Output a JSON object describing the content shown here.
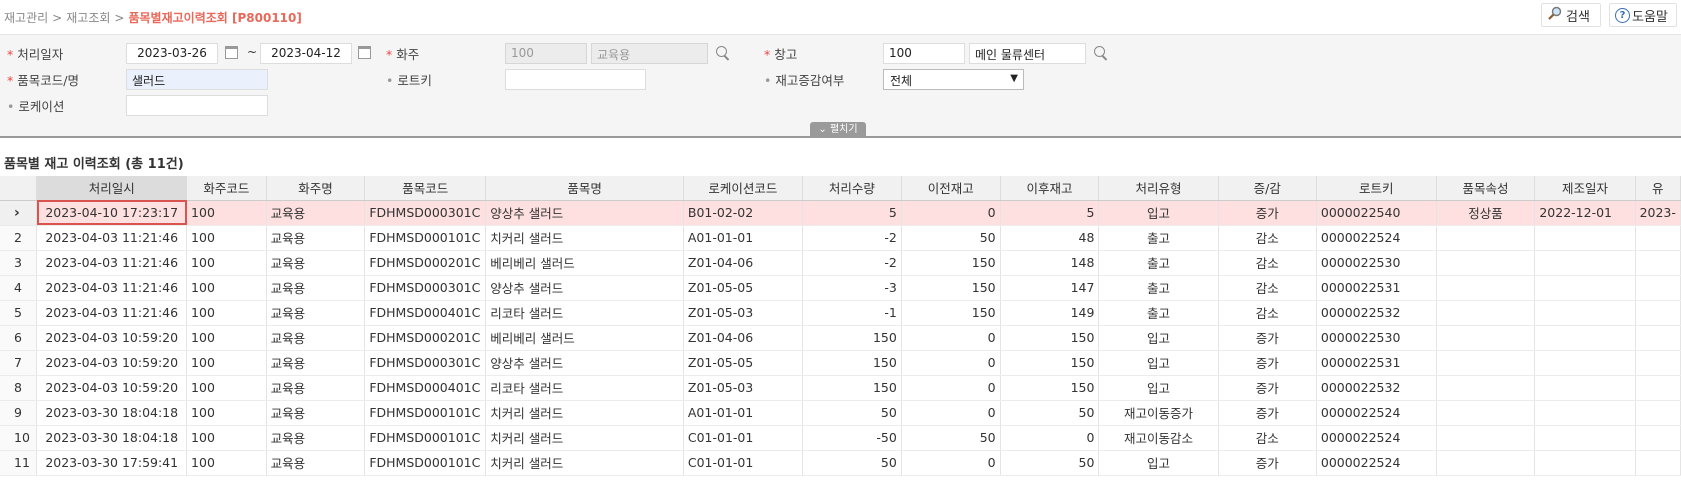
{
  "breadcrumb": {
    "items": [
      "재고관리",
      "재고조회"
    ],
    "separator": ">",
    "current": "품목별재고이력조회 [P800110]"
  },
  "topbar": {
    "search_label": "검색",
    "help_label": "도움말"
  },
  "search": {
    "date_label": "처리일자",
    "date_from": "2023-03-26",
    "date_tilde": "~",
    "date_to": "2023-04-12",
    "owner_label": "화주",
    "owner_code": "100",
    "owner_name": "교육용",
    "warehouse_label": "창고",
    "warehouse_code": "100",
    "warehouse_name": "메인 물류센터",
    "item_label": "품목코드/명",
    "item_value": "샐러드",
    "lotkey_label": "로트키",
    "lotkey_value": "",
    "change_label": "재고증감여부",
    "change_value": "전체",
    "location_label": "로케이션",
    "location_value": "",
    "fold_label": "펼치기"
  },
  "grid": {
    "title": "품목별 재고 이력조회 (총 11건)",
    "columns": [
      "처리일시",
      "화주코드",
      "화주명",
      "품목코드",
      "품목명",
      "로케이션코드",
      "처리수량",
      "이전재고",
      "이후재고",
      "처리유형",
      "증/감",
      "로트키",
      "품목속성",
      "제조일자",
      "유"
    ],
    "rows": [
      [
        "2023-04-10 17:23:17",
        "100",
        "교육용",
        "FDHMSD000301C",
        "양상추 샐러드",
        "B01-02-02",
        "5",
        "0",
        "5",
        "입고",
        "증가",
        "0000022540",
        "정상품",
        "2022-12-01",
        "2023-"
      ],
      [
        "2023-04-03 11:21:46",
        "100",
        "교육용",
        "FDHMSD000101C",
        "치커리 샐러드",
        "A01-01-01",
        "-2",
        "50",
        "48",
        "출고",
        "감소",
        "0000022524",
        "",
        "",
        ""
      ],
      [
        "2023-04-03 11:21:46",
        "100",
        "교육용",
        "FDHMSD000201C",
        "베리베리 샐러드",
        "Z01-04-06",
        "-2",
        "150",
        "148",
        "출고",
        "감소",
        "0000022530",
        "",
        "",
        ""
      ],
      [
        "2023-04-03 11:21:46",
        "100",
        "교육용",
        "FDHMSD000301C",
        "양상추 샐러드",
        "Z01-05-05",
        "-3",
        "150",
        "147",
        "출고",
        "감소",
        "0000022531",
        "",
        "",
        ""
      ],
      [
        "2023-04-03 11:21:46",
        "100",
        "교육용",
        "FDHMSD000401C",
        "리코타 샐러드",
        "Z01-05-03",
        "-1",
        "150",
        "149",
        "출고",
        "감소",
        "0000022532",
        "",
        "",
        ""
      ],
      [
        "2023-04-03 10:59:20",
        "100",
        "교육용",
        "FDHMSD000201C",
        "베리베리 샐러드",
        "Z01-04-06",
        "150",
        "0",
        "150",
        "입고",
        "증가",
        "0000022530",
        "",
        "",
        ""
      ],
      [
        "2023-04-03 10:59:20",
        "100",
        "교육용",
        "FDHMSD000301C",
        "양상추 샐러드",
        "Z01-05-05",
        "150",
        "0",
        "150",
        "입고",
        "증가",
        "0000022531",
        "",
        "",
        ""
      ],
      [
        "2023-04-03 10:59:20",
        "100",
        "교육용",
        "FDHMSD000401C",
        "리코타 샐러드",
        "Z01-05-03",
        "150",
        "0",
        "150",
        "입고",
        "증가",
        "0000022532",
        "",
        "",
        ""
      ],
      [
        "2023-03-30 18:04:18",
        "100",
        "교육용",
        "FDHMSD000101C",
        "치커리 샐러드",
        "A01-01-01",
        "50",
        "0",
        "50",
        "재고이동증가",
        "증가",
        "0000022524",
        "",
        "",
        ""
      ],
      [
        "2023-03-30 18:04:18",
        "100",
        "교육용",
        "FDHMSD000101C",
        "치커리 샐러드",
        "C01-01-01",
        "-50",
        "50",
        "0",
        "재고이동감소",
        "감소",
        "0000022524",
        "",
        "",
        ""
      ],
      [
        "2023-03-30 17:59:41",
        "100",
        "교육용",
        "FDHMSD000101C",
        "치커리 샐러드",
        "C01-01-01",
        "50",
        "0",
        "50",
        "입고",
        "증가",
        "0000022524",
        "",
        "",
        ""
      ]
    ],
    "row_numbers": [
      "",
      "2",
      "3",
      "4",
      "5",
      "6",
      "7",
      "8",
      "9",
      "10",
      "11"
    ],
    "selected_marker": "›"
  }
}
